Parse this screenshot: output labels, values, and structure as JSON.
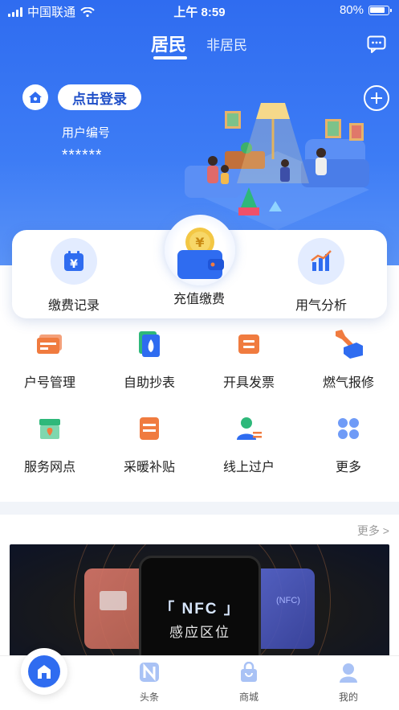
{
  "status_bar": {
    "carrier": "中国联通",
    "time": "上午 8:59",
    "battery": "80%"
  },
  "header": {
    "tabs": [
      {
        "label": "居民",
        "active": true
      },
      {
        "label": "非居民",
        "active": false
      }
    ],
    "login_button": "点击登录",
    "user_id_label": "用户编号",
    "user_id_value": "******"
  },
  "quick_card": [
    {
      "label": "缴费记录",
      "icon": "calendar-yen-icon"
    },
    {
      "label": "充值缴费",
      "icon": "wallet-coin-icon"
    },
    {
      "label": "用气分析",
      "icon": "bar-chart-icon"
    }
  ],
  "services": [
    {
      "label": "户号管理",
      "icon": "id-card-icon"
    },
    {
      "label": "自助抄表",
      "icon": "meter-flame-icon"
    },
    {
      "label": "开具发票",
      "icon": "invoice-icon"
    },
    {
      "label": "燃气报修",
      "icon": "wrench-hand-icon"
    },
    {
      "label": "服务网点",
      "icon": "store-location-icon"
    },
    {
      "label": "采暖补贴",
      "icon": "heating-subsidy-icon"
    },
    {
      "label": "线上过户",
      "icon": "user-transfer-icon"
    },
    {
      "label": "更多",
      "icon": "more-grid-icon"
    }
  ],
  "banner": {
    "more_label": "更多 >",
    "title": "「 NFC 」",
    "subtitle": "感应区位",
    "right_label": "(NFC)"
  },
  "tabbar": [
    {
      "label": "",
      "icon": "home-icon",
      "active": true
    },
    {
      "label": "头条",
      "icon": "news-icon"
    },
    {
      "label": "商城",
      "icon": "shop-bag-icon"
    },
    {
      "label": "我的",
      "icon": "profile-icon"
    }
  ],
  "colors": {
    "primary": "#2f6cf0",
    "accent_orange": "#f07b3f",
    "accent_green": "#2eb87a"
  }
}
